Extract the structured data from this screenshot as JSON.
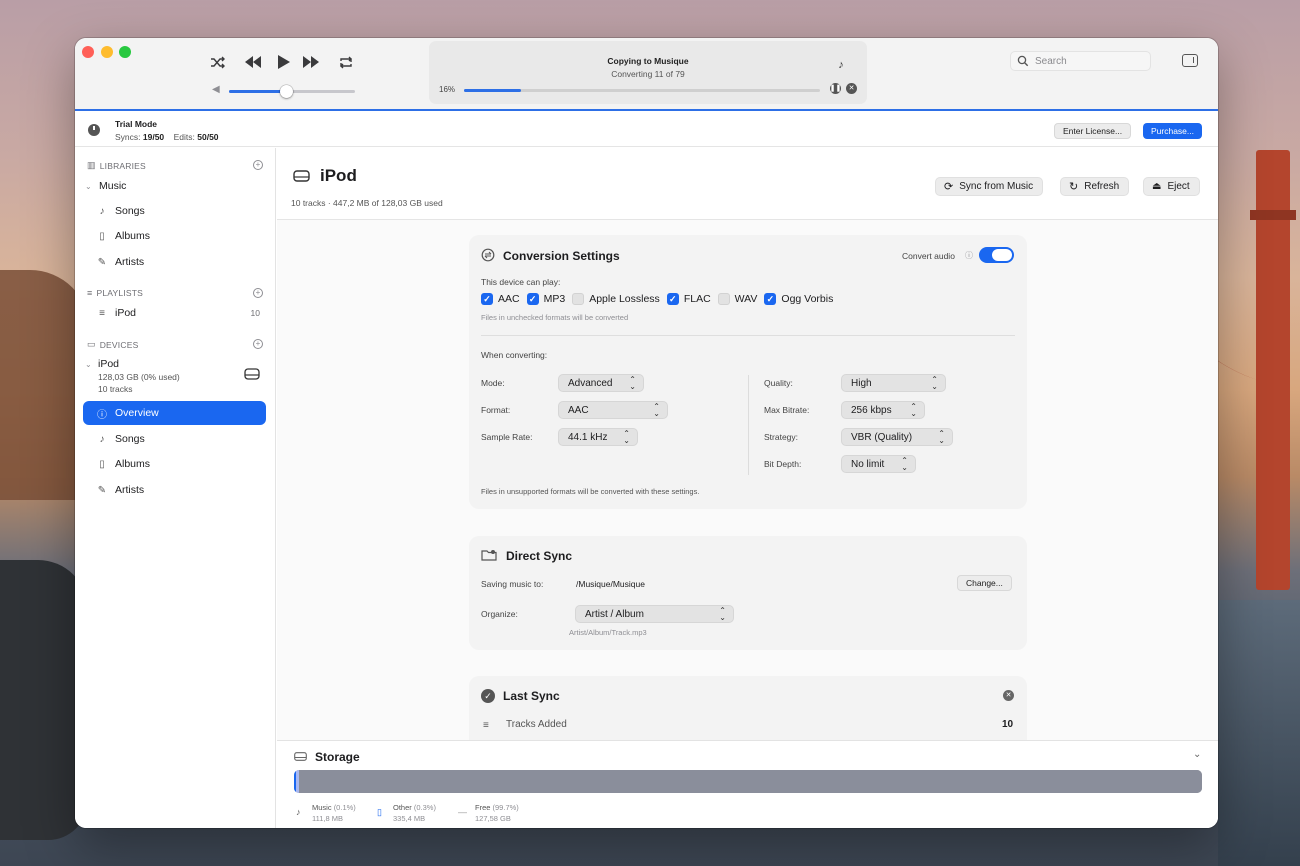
{
  "toolbar": {
    "lcd": {
      "title": "Copying to Musique",
      "subtitle": "Converting 11 of 79",
      "progress_label": "16%",
      "progress": 0.16
    },
    "volume": 0.45,
    "search": {
      "placeholder": "Search",
      "value": ""
    }
  },
  "trial": {
    "title": "Trial Mode",
    "syncs_label": "Syncs:",
    "syncs_value": "19/50",
    "edits_label": "Edits:",
    "edits_value": "50/50",
    "enter_license": "Enter License...",
    "purchase": "Purchase..."
  },
  "sidebar": {
    "libraries_header": "LIBRARIES",
    "library_name": "Music",
    "library_items": [
      {
        "label": "Songs",
        "icon": "music-note-icon"
      },
      {
        "label": "Albums",
        "icon": "album-icon"
      },
      {
        "label": "Artists",
        "icon": "microphone-icon"
      }
    ],
    "playlists_header": "PLAYLISTS",
    "playlists": [
      {
        "label": "iPod",
        "count": "10"
      }
    ],
    "devices_header": "DEVICES",
    "device": {
      "name": "iPod",
      "capacity": "128,03 GB (0% used)",
      "tracks": "10 tracks"
    },
    "device_items": [
      {
        "label": "Overview",
        "icon": "info-icon",
        "active": true
      },
      {
        "label": "Songs",
        "icon": "music-note-icon"
      },
      {
        "label": "Albums",
        "icon": "album-icon"
      },
      {
        "label": "Artists",
        "icon": "microphone-icon"
      }
    ]
  },
  "header": {
    "title": "iPod",
    "subtitle": "10 tracks  ·  447,2 MB of 128,03 GB used",
    "sync_button": "Sync from Music",
    "refresh_button": "Refresh",
    "eject_button": "Eject"
  },
  "conversion": {
    "title": "Conversion Settings",
    "convert_audio_label": "Convert audio",
    "convert_audio_on": true,
    "can_play_label": "This device can play:",
    "formats": [
      {
        "label": "AAC",
        "checked": true
      },
      {
        "label": "MP3",
        "checked": true
      },
      {
        "label": "Apple Lossless",
        "checked": false
      },
      {
        "label": "FLAC",
        "checked": true
      },
      {
        "label": "WAV",
        "checked": false
      },
      {
        "label": "Ogg Vorbis",
        "checked": true
      }
    ],
    "unchecked_hint": "Files in unchecked formats will be converted",
    "when_converting": "When converting:",
    "mode_label": "Mode:",
    "mode_value": "Advanced",
    "format_label": "Format:",
    "format_value": "AAC",
    "sample_rate_label": "Sample Rate:",
    "sample_rate_value": "44.1 kHz",
    "quality_label": "Quality:",
    "quality_value": "High",
    "bitrate_label": "Max Bitrate:",
    "bitrate_value": "256 kbps",
    "strategy_label": "Strategy:",
    "strategy_value": "VBR (Quality)",
    "bitdepth_label": "Bit Depth:",
    "bitdepth_value": "No limit",
    "footer": "Files in unsupported formats will be converted with these settings."
  },
  "direct_sync": {
    "title": "Direct Sync",
    "saving_label": "Saving music to:",
    "saving_path": "/Musique/Musique",
    "change_button": "Change...",
    "organize_label": "Organize:",
    "organize_value": "Artist / Album",
    "organize_hint": "Artist/Album/Track.mp3"
  },
  "last_sync": {
    "title": "Last Sync",
    "tracks_added_label": "Tracks Added",
    "tracks_added_value": "10"
  },
  "storage": {
    "title": "Storage",
    "segments": [
      {
        "name": "Music",
        "pct_label": "(0.1%)",
        "size": "111,8 MB",
        "fraction": 0.001,
        "color": "#1a67f0"
      },
      {
        "name": "Other",
        "pct_label": "(0.3%)",
        "size": "335,4 MB",
        "fraction": 0.003,
        "color": "#a9b8f0"
      },
      {
        "name": "Free",
        "pct_label": "(99.7%)",
        "size": "127,58 GB",
        "fraction": 0.997,
        "color": "#8a8e9b"
      }
    ]
  },
  "colors": {
    "accent": "#1a67f0",
    "toolbar_bg": "#f3f3f3",
    "card_bg": "#f3f3f3"
  }
}
